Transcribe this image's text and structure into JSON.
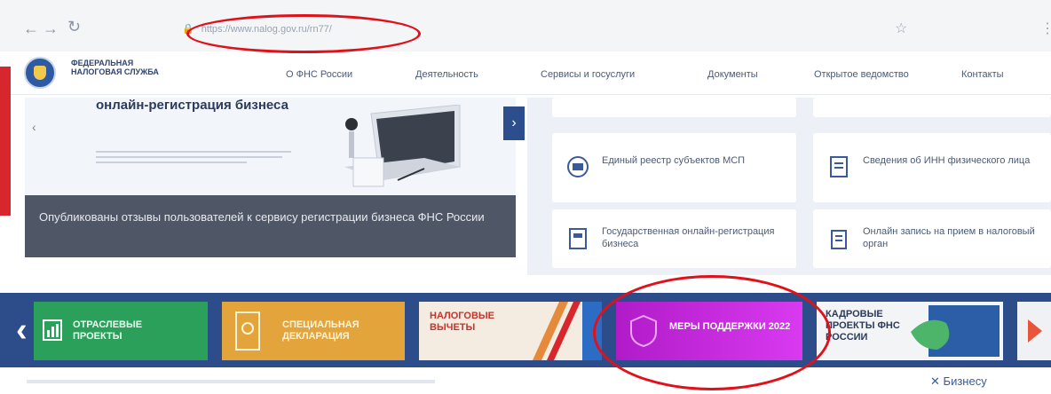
{
  "browser": {
    "url": "https://www.nalog.gov.ru/rn77/",
    "reload_icon": "reload-icon",
    "star_icon": "star-icon"
  },
  "header": {
    "org_name": "ФЕДЕРАЛЬНАЯ НАЛОГОВАЯ СЛУЖБА",
    "nav": [
      "О ФНС России",
      "Деятельность",
      "Сервисы и госуслуги",
      "Документы",
      "Открытое ведомство",
      "Контакты"
    ]
  },
  "hero": {
    "title": "онлайн-регистрация бизнеса",
    "caption": "Опубликованы отзывы пользователей к сервису регистрации бизнеса ФНС России"
  },
  "services": [
    {
      "title": "Единый реестр субъектов МСП",
      "icon": "database-icon"
    },
    {
      "title": "Сведения об ИНН физического лица",
      "icon": "document-icon"
    },
    {
      "title": "Государственная онлайн-регистрация бизнеса",
      "icon": "form-icon"
    },
    {
      "title": "Онлайн запись на прием в налоговый орган",
      "icon": "calendar-icon"
    }
  ],
  "banners": [
    {
      "label": "ОТРАСЛЕВЫЕ ПРОЕКТЫ",
      "color": "#2aa05a"
    },
    {
      "label": "СПЕЦИАЛЬНАЯ ДЕКЛАРАЦИЯ",
      "color": "#e3a43c"
    },
    {
      "label": "НАЛОГОВЫЕ ВЫЧЕТЫ",
      "color": "#f4ece0"
    },
    {
      "label": "МЕРЫ ПОДДЕРЖКИ 2022",
      "color": "#c41fd8"
    },
    {
      "label": "КАДРОВЫЕ ПРОЕКТЫ ФНС РОССИИ",
      "color": "#f3f4f6"
    }
  ],
  "footer": {
    "right_text": "Бизнесу"
  },
  "colors": {
    "brand_blue": "#2c4d8a",
    "annotation_red": "#e0111a"
  }
}
